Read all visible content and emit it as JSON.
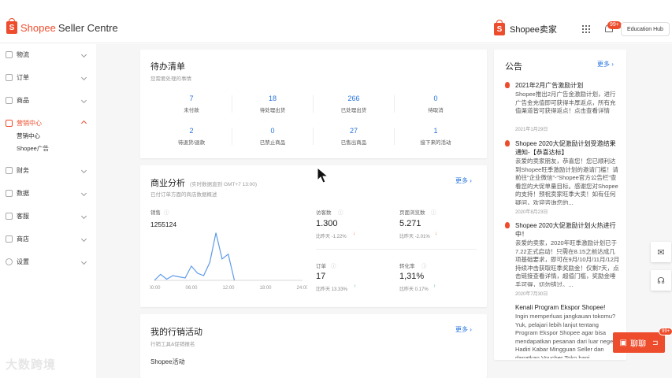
{
  "header": {
    "brand": "Shopee",
    "title": "Seller Centre",
    "seller_app": "Shopee卖家",
    "bell_badge": "99+",
    "education_hub": "Education Hub"
  },
  "sidebar": {
    "items": [
      {
        "label": "物流",
        "icon": "truck-icon"
      },
      {
        "label": "订单",
        "icon": "clipboard-icon"
      },
      {
        "label": "商品",
        "icon": "box-icon"
      },
      {
        "label": "营销中心",
        "icon": "tag-icon",
        "active": true
      },
      {
        "label": "财务",
        "icon": "wallet-icon"
      },
      {
        "label": "数据",
        "icon": "chart-icon"
      },
      {
        "label": "客服",
        "icon": "headset-icon"
      },
      {
        "label": "商店",
        "icon": "store-icon"
      },
      {
        "label": "设置",
        "icon": "gear-icon"
      }
    ],
    "sub_items": [
      "营销中心",
      "Shopee广告"
    ]
  },
  "todo": {
    "title": "待办清单",
    "subtitle": "您需要处理的事情",
    "items": [
      {
        "value": "7",
        "label": "未付款"
      },
      {
        "value": "18",
        "label": "待处理出货"
      },
      {
        "value": "266",
        "label": "已处理出货"
      },
      {
        "value": "0",
        "label": "待取消"
      },
      {
        "value": "2",
        "label": "待退货/退款"
      },
      {
        "value": "0",
        "label": "已禁止商品"
      },
      {
        "value": "27",
        "label": "已售出商品"
      },
      {
        "value": "1",
        "label": "接下来的活动"
      }
    ]
  },
  "analytics": {
    "title": "商业分析",
    "title_note": "(实时数据直到 GMT+7 13:00)",
    "subtitle": "已付订单方面的商店数据概述",
    "more": "更多",
    "sales_label": "销售",
    "sales_value": "1255124",
    "visitors": {
      "label": "访客数",
      "value": "1.300",
      "cmp": "比昨天 -1.22%"
    },
    "pageviews": {
      "label": "页面浏览数",
      "value": "5.271",
      "cmp": "比昨天 -2.01%"
    },
    "orders": {
      "label": "订单",
      "value": "17",
      "cmp": "比昨天 13.33%"
    },
    "conversion": {
      "label": "转化率",
      "value": "1,31%",
      "cmp": "比昨天 0.17%"
    }
  },
  "chart_data": {
    "type": "line",
    "x_ticks": [
      "00:00",
      "06:00",
      "12:00",
      "18:00",
      "24:00"
    ],
    "x": [
      0,
      1,
      2,
      3,
      4,
      5,
      6,
      7,
      8,
      9,
      10,
      11,
      12,
      13
    ],
    "values": [
      0,
      0.5,
      0.1,
      0.4,
      0.3,
      0.2,
      1.2,
      0.6,
      0.4,
      1.5,
      4.0,
      1.8,
      2.2,
      0
    ],
    "ylim": [
      0,
      4.5
    ],
    "grid": false
  },
  "marketing": {
    "title": "我的行销活动",
    "subtitle": "行销工具&促销报名",
    "more": "更多",
    "row1": "Shopee活动"
  },
  "announcements": {
    "title": "公告",
    "more": "更多",
    "items": [
      {
        "title": "2021年2月广告激励计划",
        "body": "Shopee推出2月广告金激励计划，进行广告金充值即可获得丰厚返点，所有充值渠道皆可获得返点！点击查看详情",
        "date": "2021年1月29日",
        "hot": true
      },
      {
        "title": "Shopee 2020大促激励计划受邀结果通知-【恭喜达标】",
        "body": "亲爱的卖家朋友，恭喜您！您已顺利达到Shopee旺季激励计划的邀请门槛！请前往“企业微信”-“Shopee官方公告栏”查看您的大促单量目标。感谢您对Shopee的支持！预祝卖家旺季大卖！如有任何疑问，欢迎咨询您的...",
        "date": "2020年8月23日",
        "hot": true
      },
      {
        "title": "Shopee 2020大促激励计划火热进行中！",
        "body": "亲爱的卖家，2020年旺季激励计划已于7.22正式启动！只需在8.15之前达成几项基础要求，即可在9月/10月/11月/12月持续冲击获取旺季奖励金！仅剩7天，点击链接查看详情，超值门槛，奖励金唾手可得，切勿错过。...",
        "date": "2020年7月30日",
        "hot": true
      },
      {
        "title": "Kenali Program Ekspor Shopee!",
        "body": "Ingin memperluas jangkauan tokomu? Yuk, pelajari lebih lanjut tentang Program Ekspor Shopee agar bisa mendapatkan pesanan dari luar negeri! Hadiri Kabar Mingguan Seller dan dapatkan Voucher Toko bagi...",
        "date": "",
        "hot": false
      }
    ]
  },
  "chat": {
    "label": "聊聊",
    "badge": "99+"
  },
  "watermark": "大数跨境",
  "colors": {
    "brand": "#ee4d2d",
    "link": "#2673dd",
    "down": "#ee4d2d",
    "up": "#26aa99"
  }
}
